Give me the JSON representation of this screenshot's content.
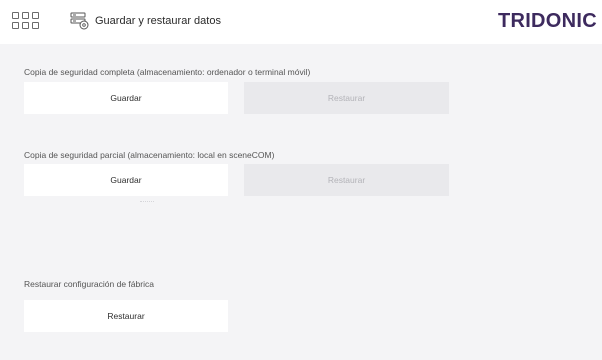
{
  "header": {
    "title": "Guardar y restaurar datos",
    "logo": "TRIDONIC",
    "menu_icon": "app-grid-icon",
    "page_icon": "backup-settings-icon"
  },
  "sections": [
    {
      "label": "Copia de seguridad completa (almacenamiento: ordenador o terminal móvil)",
      "save_label": "Guardar",
      "restore_label": "Restaurar",
      "restore_enabled": false
    },
    {
      "label": "Copia de seguridad parcial (almacenamiento: local en sceneCOM)",
      "save_label": "Guardar",
      "restore_label": "Restaurar",
      "restore_enabled": false
    },
    {
      "label": "Restaurar configuración de fábrica",
      "restore_label": "Restaurar",
      "restore_enabled": true
    }
  ],
  "colors": {
    "background": "#f4f4f6",
    "button": "#ffffff",
    "button_disabled": "#e9e9ec",
    "brand": "#3d2a5e"
  }
}
